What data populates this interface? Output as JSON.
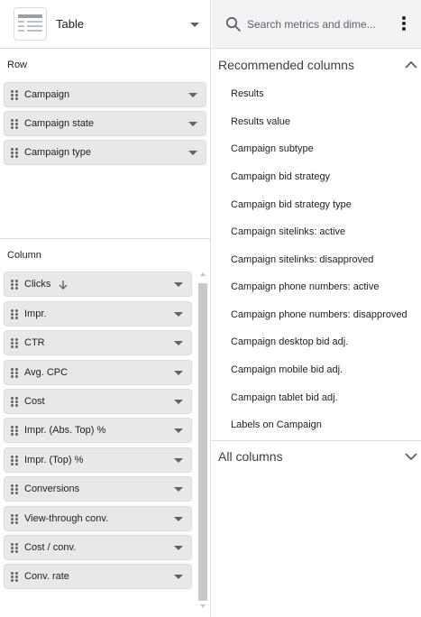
{
  "visualization": {
    "selected": "Table",
    "icon": "table-chart-icon"
  },
  "search": {
    "placeholder": "Search metrics and dime..."
  },
  "row_section": {
    "title": "Row",
    "chips": [
      {
        "label": "Campaign"
      },
      {
        "label": "Campaign state"
      },
      {
        "label": "Campaign type"
      }
    ]
  },
  "column_section": {
    "title": "Column",
    "chips": [
      {
        "label": "Clicks",
        "sort": "descending"
      },
      {
        "label": "Impr."
      },
      {
        "label": "CTR"
      },
      {
        "label": "Avg. CPC"
      },
      {
        "label": "Cost"
      },
      {
        "label": "Impr. (Abs. Top) %"
      },
      {
        "label": "Impr. (Top) %"
      },
      {
        "label": "Conversions"
      },
      {
        "label": "View-through conv."
      },
      {
        "label": "Cost / conv."
      },
      {
        "label": "Conv. rate"
      }
    ]
  },
  "recommended": {
    "title": "Recommended columns",
    "expanded": true,
    "items": [
      "Results",
      "Results value",
      "Campaign subtype",
      "Campaign bid strategy",
      "Campaign bid strategy type",
      "Campaign sitelinks: active",
      "Campaign sitelinks: disapproved",
      "Campaign phone numbers: active",
      "Campaign phone numbers: disapproved",
      "Campaign desktop bid adj.",
      "Campaign mobile bid adj.",
      "Campaign tablet bid adj.",
      "Labels on Campaign"
    ]
  },
  "all_columns": {
    "title": "All columns",
    "expanded": false
  }
}
